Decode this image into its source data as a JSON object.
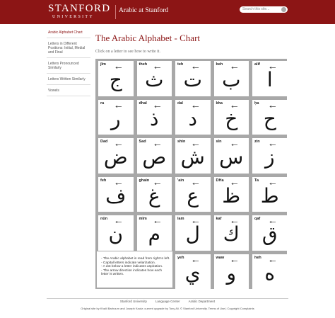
{
  "header": {
    "logo_main": "STANFORD",
    "logo_sub": "UNIVERSITY",
    "site_title": "Arabic at Stanford",
    "search_placeholder": "Search this site..."
  },
  "sidebar": {
    "items": [
      {
        "label": "Arabic Alphabet Chart",
        "active": true
      },
      {
        "label": "Letters in Different Positions: Initial, Medial and Final",
        "active": false
      },
      {
        "label": "Letters Pronounced Similarly",
        "active": false
      },
      {
        "label": "Letters Written Similarly",
        "active": false
      },
      {
        "label": "Vowels",
        "active": false
      }
    ]
  },
  "main": {
    "title": "The Arabic Alphabet - Chart",
    "instruction": "Click on a letter to see how to write it.",
    "letters": [
      {
        "name": "jīm",
        "glyph": "ج"
      },
      {
        "name": "theh",
        "glyph": "ث"
      },
      {
        "name": "teh",
        "glyph": "ت"
      },
      {
        "name": "beh",
        "glyph": "ب"
      },
      {
        "name": "alif",
        "glyph": "ا"
      },
      {
        "name": "ra",
        "glyph": "ر"
      },
      {
        "name": "dhal",
        "glyph": "ذ"
      },
      {
        "name": "dal",
        "glyph": "د"
      },
      {
        "name": "kha",
        "glyph": "خ"
      },
      {
        "name": "ḥa",
        "glyph": "ح"
      },
      {
        "name": "Dad",
        "glyph": "ض"
      },
      {
        "name": "Sad",
        "glyph": "ص"
      },
      {
        "name": "shin",
        "glyph": "ش"
      },
      {
        "name": "sīn",
        "glyph": "س"
      },
      {
        "name": "zin",
        "glyph": "ز"
      },
      {
        "name": "feh",
        "glyph": "ف"
      },
      {
        "name": "ghain",
        "glyph": "غ"
      },
      {
        "name": "'ain",
        "glyph": "ع"
      },
      {
        "name": "DHa",
        "glyph": "ظ"
      },
      {
        "name": "Ta",
        "glyph": "ط"
      },
      {
        "name": "nūn",
        "glyph": "ن"
      },
      {
        "name": "mīm",
        "glyph": "م"
      },
      {
        "name": "lam",
        "glyph": "ل"
      },
      {
        "name": "kaf",
        "glyph": "ك"
      },
      {
        "name": "qaf",
        "glyph": "ق"
      },
      {
        "name": "yeh",
        "glyph": "ي"
      },
      {
        "name": "waw",
        "glyph": "و"
      },
      {
        "name": "heh",
        "glyph": "ه"
      }
    ],
    "notes": [
      "- The Arabic alphabet is read from right to left.",
      "- Capital letters indicate velarization.",
      "- A dot below a letter indicates aspiration.",
      "- The arrow direction indicates how each letter is written."
    ]
  },
  "footer": {
    "links": [
      "Stanford University",
      "Language Center",
      "Arabic Department"
    ],
    "credits": "Original site by Khalil Barhoum and Joseph Kautz; current upgrade by Tony Ali. © Stanford University. Terms of Use | Copyright Complaints"
  }
}
